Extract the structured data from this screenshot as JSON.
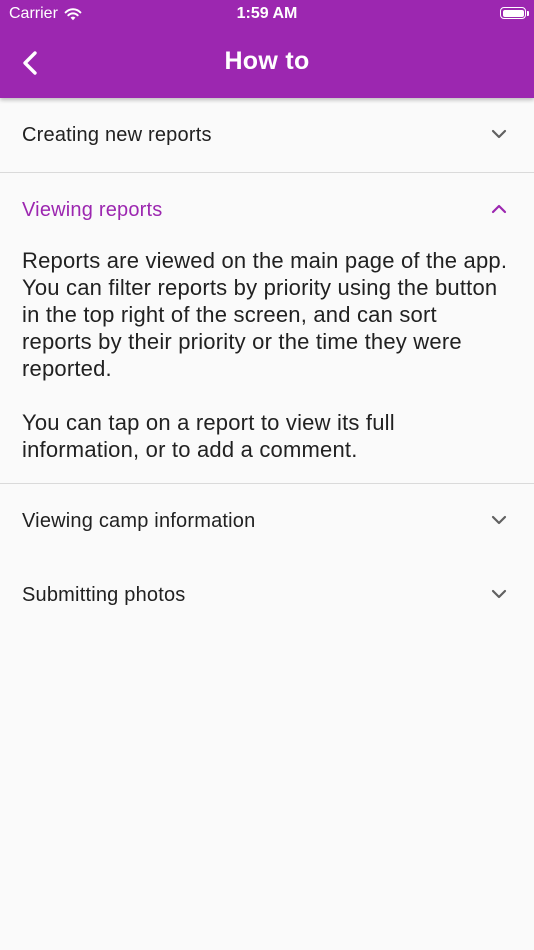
{
  "status_bar": {
    "carrier": "Carrier",
    "time": "1:59 AM",
    "wifi_icon": "wifi-icon",
    "battery_icon": "battery-icon",
    "battery_level": 1.0
  },
  "app_bar": {
    "title": "How to",
    "back_icon": "chevron-left-icon",
    "background_color": "#9c27b0"
  },
  "panels": [
    {
      "title": "Creating new reports",
      "expanded": false,
      "icon": "chevron-down-icon"
    },
    {
      "title": "Viewing reports",
      "expanded": true,
      "icon": "chevron-up-icon",
      "body": [
        "Reports are viewed on the main page of the app. You can filter reports by priority using the button in the top right of the screen, and can sort reports by their priority or the time they were reported.",
        "You can tap on a report to view its full information, or to add a comment."
      ]
    },
    {
      "title": "Viewing camp information",
      "expanded": false,
      "icon": "chevron-down-icon"
    },
    {
      "title": "Submitting photos",
      "expanded": false,
      "icon": "chevron-down-icon"
    }
  ],
  "colors": {
    "accent": "#9c27b0",
    "background": "#fafafa",
    "divider": "#dadada",
    "text": "#212121"
  }
}
